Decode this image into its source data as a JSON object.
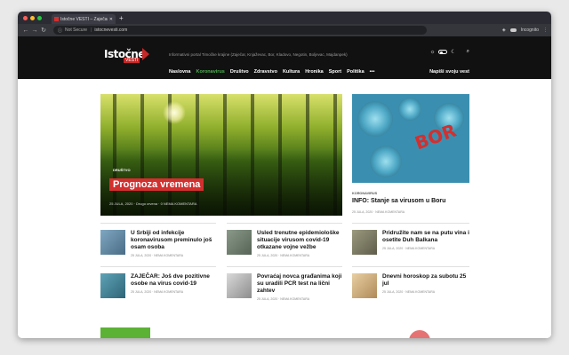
{
  "browser": {
    "tab_title": "Istočne VESTI – Zaječar, Knjaževac",
    "address_security": "Not Secure",
    "address_url": "istocnevesti.com",
    "incognito_label": "Incognito"
  },
  "site": {
    "logo_line1": "Istočne",
    "logo_line2": "VESTI",
    "tagline": "Informativni portal Timočke krajine (Zaječar, Knjaževac, Bor, Kladovo, Negotin, Boljevac, Majdanpek)",
    "nav": [
      "Naslovna",
      "Koronavirus",
      "Društvo",
      "Zdravstvo",
      "Kultura",
      "Hronika",
      "Sport",
      "Politika",
      "•••"
    ],
    "submit_label": "Napiši svoju vest"
  },
  "hero": {
    "category": "DRUŠTVO",
    "title": "Prognoza vremena",
    "meta": "25 JULA, 2020 · Drugo crvena · 0 NEMA KOMENTARA"
  },
  "side_top": {
    "image_text": "BOR",
    "category": "KORONAVIRUS",
    "title": "INFO: Stanje sa virusom u Boru",
    "meta": "25 JULA, 2020 · NEMA KOMENTARA"
  },
  "cards": [
    {
      "title": "U Srbiji od infekcije koronavirusom preminulo još osam osoba",
      "meta": "25 JULA, 2020 · NEMA KOMENTARA"
    },
    {
      "title": "Usled trenutne epidemiološke situacije virusom covid-19 otkazane vojne vežbe",
      "meta": "25 JULA, 2020 · NEMA KOMENTARA"
    },
    {
      "title": "Pridružite nam se na putu vina i osetite Duh Balkana",
      "meta": "25 JULA, 2020 · NEMA KOMENTARA"
    },
    {
      "title": "ZAJEČAR: Još dve pozitivne osobe na virus covid-19",
      "meta": "25 JULA, 2020 · NEMA KOMENTARA"
    },
    {
      "title": "Povraćaj novca građanima koji su uradili PCR test na lični zahtev",
      "meta": "25 JULA, 2020 · NEMA KOMENTARA"
    },
    {
      "title": "Dnevni horoskop za subotu 25 jul",
      "meta": "25 JULA, 2020 · NEMA KOMENTARA"
    }
  ],
  "colors": {
    "accent_red": "#d32f2f",
    "accent_green": "#4caf50",
    "header_bg": "#111111"
  }
}
